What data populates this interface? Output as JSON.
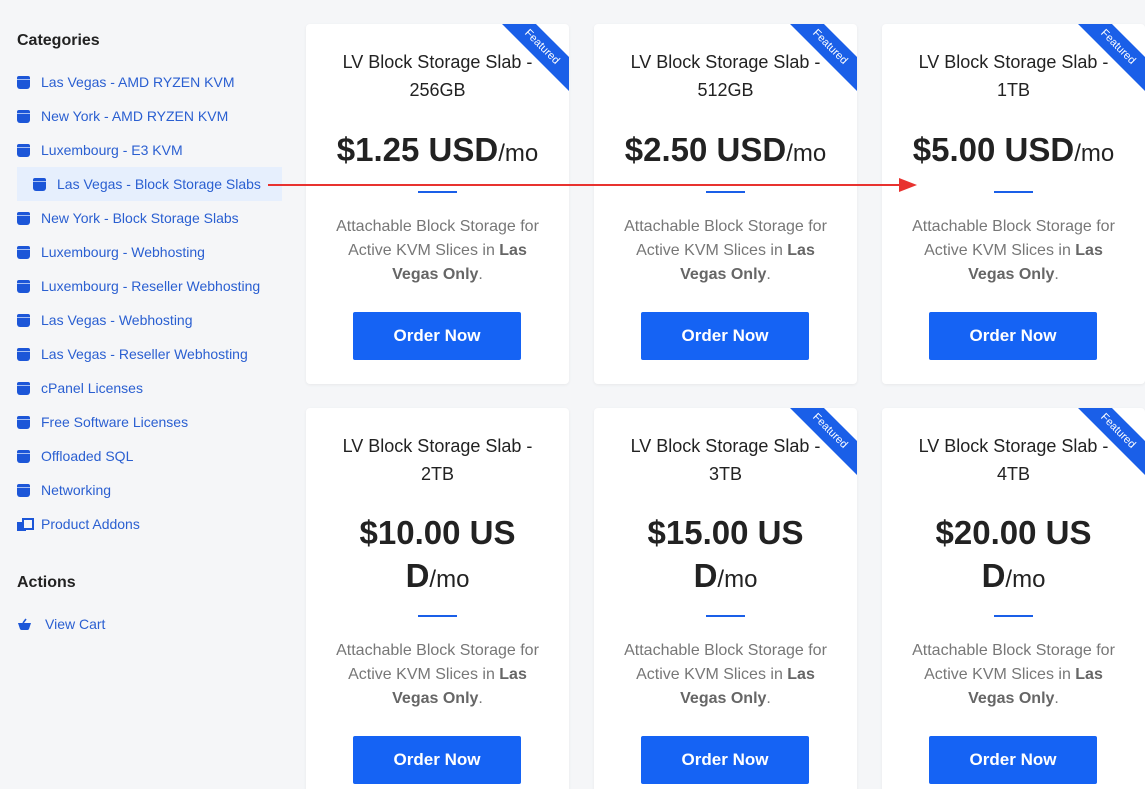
{
  "sidebar": {
    "categories_heading": "Categories",
    "items": [
      {
        "label": "Las Vegas - AMD RYZEN KVM",
        "icon": "box-icon"
      },
      {
        "label": "New York - AMD RYZEN KVM",
        "icon": "box-icon"
      },
      {
        "label": "Luxembourg - E3 KVM",
        "icon": "box-icon"
      },
      {
        "label": "Las Vegas - Block Storage Slabs",
        "icon": "box-icon",
        "active": true
      },
      {
        "label": "New York - Block Storage Slabs",
        "icon": "box-icon"
      },
      {
        "label": "Luxembourg - Webhosting",
        "icon": "box-icon"
      },
      {
        "label": "Luxembourg - Reseller Webhosting",
        "icon": "box-icon"
      },
      {
        "label": "Las Vegas - Webhosting",
        "icon": "box-icon"
      },
      {
        "label": "Las Vegas - Reseller Webhosting",
        "icon": "box-icon"
      },
      {
        "label": "cPanel Licenses",
        "icon": "box-icon"
      },
      {
        "label": "Free Software Licenses",
        "icon": "box-icon"
      },
      {
        "label": "Offloaded SQL",
        "icon": "box-icon"
      },
      {
        "label": "Networking",
        "icon": "box-icon"
      },
      {
        "label": "Product Addons",
        "icon": "addon-icon"
      }
    ],
    "actions_heading": "Actions",
    "actions": [
      {
        "label": "View Cart",
        "icon": "cart-icon"
      }
    ]
  },
  "products": [
    {
      "title": "LV Block Storage Slab - 256GB",
      "price": "$1.25 USD",
      "unit": "/mo",
      "featured": true
    },
    {
      "title": "LV Block Storage Slab - 512GB",
      "price": "$2.50 USD",
      "unit": "/mo",
      "featured": true
    },
    {
      "title": "LV Block Storage Slab - 1TB",
      "price": "$5.00 USD",
      "unit": "/mo",
      "featured": true
    },
    {
      "title": "LV Block Storage Slab - 2TB",
      "price": "$10.00 USD",
      "unit": "/mo",
      "featured": false
    },
    {
      "title": "LV Block Storage Slab - 3TB",
      "price": "$15.00 USD",
      "unit": "/mo",
      "featured": true
    },
    {
      "title": "LV Block Storage Slab - 4TB",
      "price": "$20.00 USD",
      "unit": "/mo",
      "featured": true
    }
  ],
  "common": {
    "desc_prefix": "Attachable Block Storage for Active KVM Slices in ",
    "desc_bold": "Las Vegas Only",
    "desc_suffix": ".",
    "order_label": "Order Now",
    "featured_label": "Featured"
  },
  "colors": {
    "accent": "#1563f4",
    "link": "#2a5fd1",
    "annotation_arrow": "#e8322f"
  }
}
